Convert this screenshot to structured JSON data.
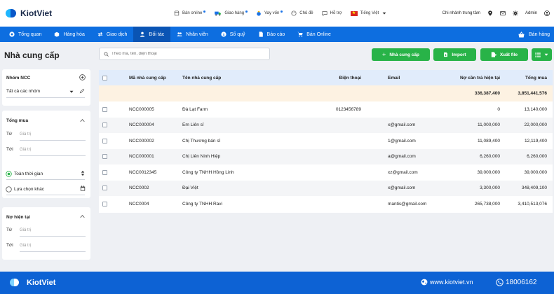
{
  "brand": {
    "name": "KiotViet"
  },
  "topbar": {
    "links": [
      {
        "label": "Bán online",
        "has_dot": true
      },
      {
        "label": "Giao hàng",
        "has_dot": true
      },
      {
        "label": "Vay vốn",
        "has_dot": true
      },
      {
        "label": "Chủ đề",
        "has_dot": false
      },
      {
        "label": "Hỗ trợ",
        "has_dot": false
      },
      {
        "label": "Tiếng Việt",
        "has_dot": false
      }
    ],
    "branch": "Chi nhánh trung tâm",
    "user": "Admin"
  },
  "nav": {
    "items": [
      "Tổng quan",
      "Hàng hóa",
      "Giao dịch",
      "Đối tác",
      "Nhân viên",
      "Sổ quỹ",
      "Báo cáo",
      "Bán Online"
    ],
    "active_index": 3,
    "sell_label": "Bán hàng"
  },
  "page": {
    "title": "Nhà cung cấp",
    "search_placeholder": "Theo mã, tên, điện thoại",
    "btn_add": "Nhà cung cấp",
    "btn_import": "Import",
    "btn_export": "Xuất file"
  },
  "sidebar": {
    "group": {
      "title": "Nhóm NCC",
      "value": "Tất cả các nhóm"
    },
    "total_buy": {
      "title": "Tổng mua",
      "from_label": "Từ",
      "to_label": "Tới",
      "placeholder": "Giá trị",
      "opt_all_time": "Toàn thời gian",
      "opt_custom": "Lựa chọn khác"
    },
    "debt": {
      "title": "Nợ hiện tại",
      "from_label": "Từ",
      "to_label": "Tới",
      "placeholder": "Giá trị"
    }
  },
  "table": {
    "headers": {
      "code": "Mã nhà cung cấp",
      "name": "Tên nhà cung cấp",
      "phone": "Điện thoại",
      "email": "Email",
      "debt": "Nợ cần trả hiện tại",
      "total": "Tổng mua"
    },
    "summary": {
      "debt": "336,387,400",
      "total": "3,851,441,576"
    },
    "rows": [
      {
        "code": "NCC000005",
        "name": "Đà Lạt Farm",
        "phone": "0123456789",
        "email": "",
        "debt": "0",
        "total": "13,140,000"
      },
      {
        "code": "NCC000004",
        "name": "Em Liên sỉ",
        "phone": "",
        "email": "x@gmail.com",
        "debt": "11,000,000",
        "total": "22,000,000"
      },
      {
        "code": "NCC000002",
        "name": "Chị Thương bán sỉ",
        "phone": "",
        "email": "1@gmail.com",
        "debt": "11,089,400",
        "total": "12,119,400"
      },
      {
        "code": "NCC000001",
        "name": "Chị Liên Ninh Hiệp",
        "phone": "",
        "email": "a@gmail.com",
        "debt": "6,260,000",
        "total": "6,260,000"
      },
      {
        "code": "NCC0012345",
        "name": "Công ty TNHH Hồng Linh",
        "phone": "",
        "email": "xz@gmail.com",
        "debt": "39,000,000",
        "total": "39,000,000"
      },
      {
        "code": "NCC0002",
        "name": "Đại Việt",
        "phone": "",
        "email": "x@gmail.com",
        "debt": "3,300,000",
        "total": "348,409,100"
      },
      {
        "code": "NCC0004",
        "name": "Công ty TNHH Ravi",
        "phone": "",
        "email": "mantis@gmail.com",
        "debt": "265,738,000",
        "total": "3,410,513,076"
      }
    ]
  },
  "footer": {
    "brand": "KiotViet",
    "website": "www.kiotviet.vn",
    "hotline": "18006162"
  },
  "colors": {
    "primary": "#0d6ee0",
    "nav_active": "#0a54b4",
    "green": "#28b348",
    "header_row": "#e1ecfb",
    "summary_row": "#fdf2e2"
  }
}
